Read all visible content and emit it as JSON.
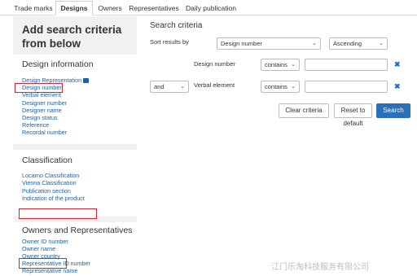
{
  "tabs": [
    "Trade marks",
    "Designs",
    "Owners",
    "Representatives",
    "Daily publication"
  ],
  "left": {
    "heading": "Add search criteria from below",
    "design_info": {
      "title": "Design information",
      "links": [
        "Design Representation",
        "Design number",
        "Verbal element",
        "Designer number",
        "Designer name",
        "Design status",
        "Reference",
        "Recordal number"
      ]
    },
    "classification": {
      "title": "Classification",
      "links": [
        "Locarno Classification",
        "Vienna Classification",
        "Publication section",
        "Indication of the product"
      ]
    },
    "owners": {
      "title": "Owners and Representatives",
      "links": [
        "Owner ID number",
        "Owner name",
        "Owner country",
        "Representative ID number",
        "Representative name"
      ]
    }
  },
  "criteria": {
    "title": "Search criteria",
    "sort_label": "Sort results by",
    "sort_field": "Design number",
    "sort_order": "Ascending",
    "row1_label": "Design number",
    "row1_op": "contains",
    "row2_conj": "and",
    "row2_label": "Verbal element",
    "row2_op": "contains",
    "clear_label": "Clear criteria",
    "reset_label": "Reset to default",
    "search_label": "Search"
  },
  "watermark": "江门乐淘科技服务有限公司",
  "colors": {
    "link": "#1f5fa8",
    "primary": "#2a6fba",
    "highlight": "#e0202a",
    "panel": "#f1f1f1"
  }
}
